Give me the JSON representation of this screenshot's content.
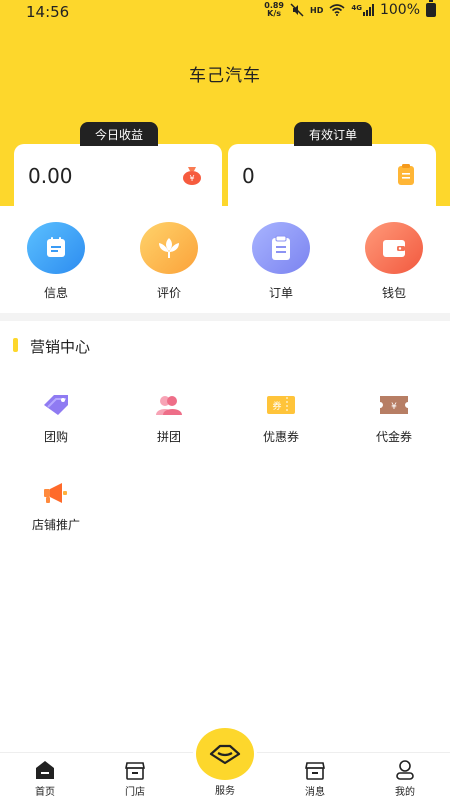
{
  "status_bar": {
    "time": "14:56",
    "net_speed": "0.89",
    "net_unit": "K/s",
    "hd": "HD",
    "signal": "4G",
    "battery": "100%"
  },
  "app_title": "车己汽车",
  "stats": {
    "today_income": {
      "label": "今日收益",
      "value": "0.00"
    },
    "valid_orders": {
      "label": "有效订单",
      "value": "0"
    }
  },
  "quick_actions": [
    {
      "label": "信息",
      "icon": "info-icon"
    },
    {
      "label": "评价",
      "icon": "review-icon"
    },
    {
      "label": "订单",
      "icon": "order-icon"
    },
    {
      "label": "钱包",
      "icon": "wallet-icon"
    }
  ],
  "marketing": {
    "title": "营销中心",
    "items": [
      {
        "label": "团购",
        "icon": "group-buy-icon"
      },
      {
        "label": "拼团",
        "icon": "team-buy-icon"
      },
      {
        "label": "优惠券",
        "icon": "coupon-icon",
        "icon_text": "券"
      },
      {
        "label": "代金券",
        "icon": "voucher-icon",
        "icon_text": "¥"
      },
      {
        "label": "店铺推广",
        "icon": "promotion-icon"
      }
    ]
  },
  "tabbar": {
    "home": "首页",
    "store": "门店",
    "service": "服务",
    "messages": "消息",
    "mine": "我的"
  },
  "colors": {
    "brand_yellow": "#FDD72C",
    "dark": "#222222"
  }
}
